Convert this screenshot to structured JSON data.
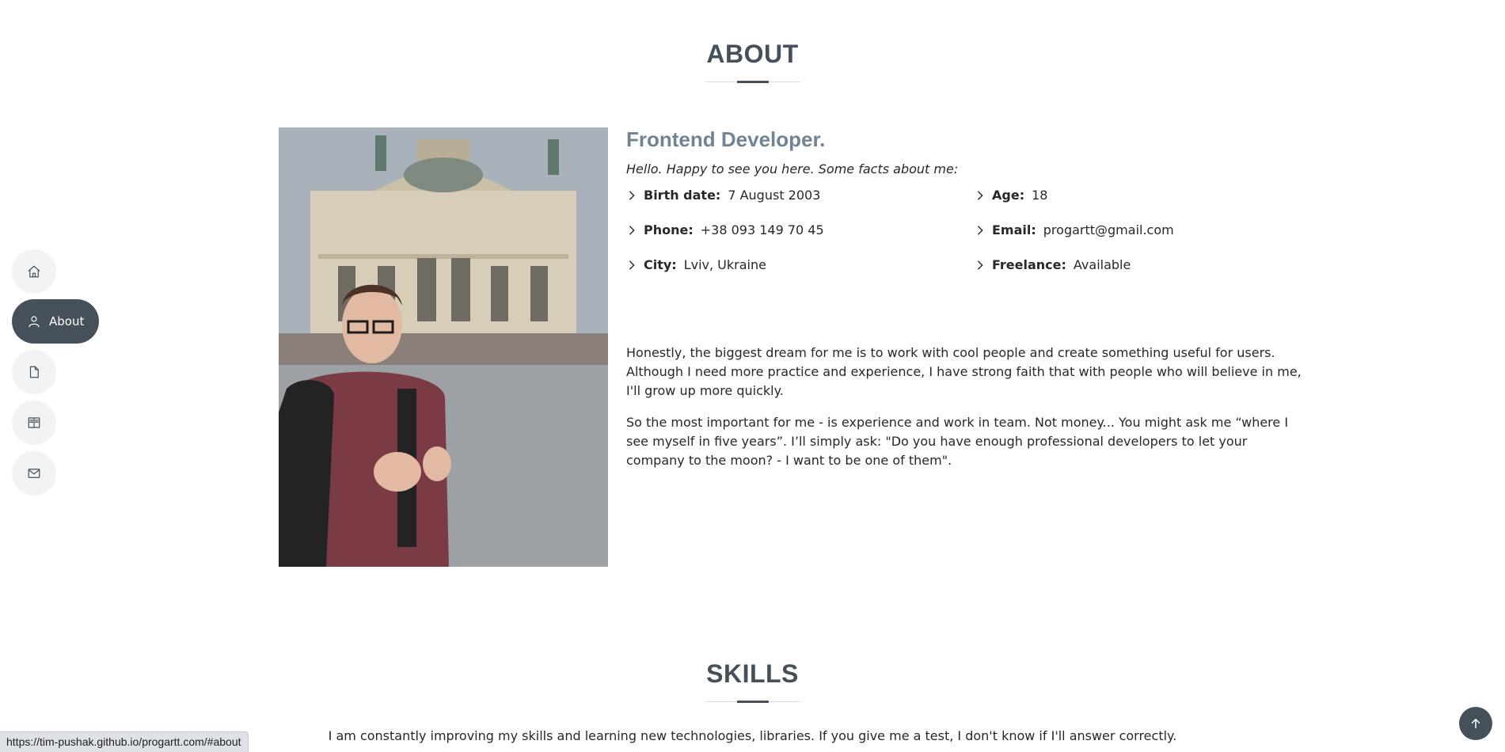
{
  "nav": {
    "items": [
      {
        "id": "home",
        "icon": "house-icon",
        "label": ""
      },
      {
        "id": "about",
        "icon": "person-icon",
        "label": "About",
        "active": true
      },
      {
        "id": "resume",
        "icon": "file-icon",
        "label": ""
      },
      {
        "id": "portfolio",
        "icon": "book-icon",
        "label": ""
      },
      {
        "id": "contact",
        "icon": "envelope-icon",
        "label": ""
      }
    ]
  },
  "about": {
    "title": "ABOUT",
    "role": "Frontend Developer.",
    "intro": "Hello. Happy to see you here. Some facts about me:",
    "facts": {
      "birth": {
        "label": "Birth date:",
        "value": "7 August 2003"
      },
      "age": {
        "label": "Age:",
        "value": "18"
      },
      "phone": {
        "label": "Phone:",
        "value": "+38 093 149 70 45"
      },
      "email": {
        "label": "Email:",
        "value": "progartt@gmail.com"
      },
      "city": {
        "label": "City:",
        "value": "Lviv, Ukraine"
      },
      "freelance": {
        "label": "Freelance:",
        "value": "Available"
      }
    },
    "paragraph1_line1": "Honestly, the biggest dream for me is to work with cool people and create something useful for users.",
    "paragraph1_line2": "Although I need more practice and experience, I have strong faith that with people who will believe in me, I'll grow up more quickly.",
    "paragraph2": "So the most important for me - is experience and work in team. Not money... You might ask me “where I see myself in five years”. I’ll simply ask: \"Do you have enough professional developers to let your company to the moon? - I want to be one of them\"."
  },
  "skills": {
    "title": "SKILLS",
    "intro": "I am constantly improving my skills and learning new technologies, libraries. If you give me a test, I don't know if I'll answer correctly."
  },
  "status_bar": {
    "url": "https://tim-pushak.github.io/progartt.com/#about"
  },
  "colors": {
    "accent": "#45505b",
    "role": "#728394",
    "nav_bg": "#f2f3f5"
  }
}
